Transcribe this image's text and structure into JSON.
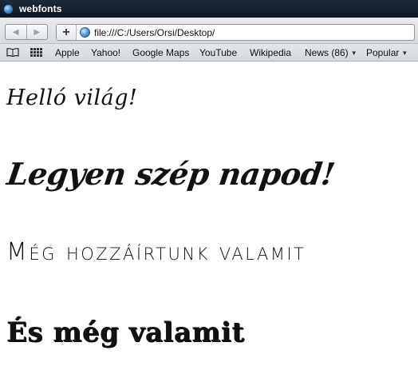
{
  "window": {
    "title": "webfonts",
    "icon": "globe-icon"
  },
  "toolbar": {
    "back_icon": "◀",
    "forward_icon": "▶",
    "add_tab_label": "+",
    "url": "file:///C:/Users/Orsi/Desktop/"
  },
  "bookmarks": {
    "items": [
      {
        "label": "Apple"
      },
      {
        "label": "Yahoo!"
      },
      {
        "label": "Google Maps"
      },
      {
        "label": "YouTube"
      },
      {
        "label": "Wikipedia"
      },
      {
        "label": "News (86)"
      },
      {
        "label": "Popular"
      }
    ],
    "caret": "▼"
  },
  "content": {
    "lines": [
      "Helló világ!",
      "Legyen szép napod!",
      "Még hozzáírtunk valamit",
      "És még valamit"
    ]
  },
  "colors": {
    "titlebar": "#152230",
    "text": "#111111",
    "background": "#ffffff"
  }
}
